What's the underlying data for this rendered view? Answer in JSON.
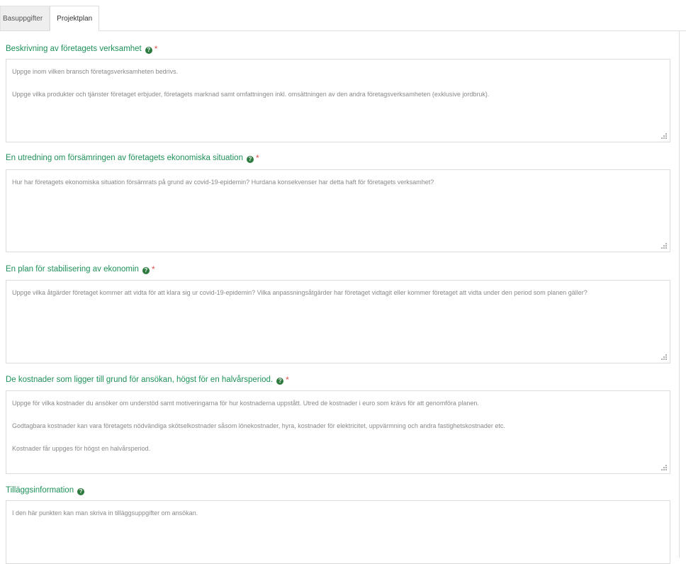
{
  "tabs": [
    {
      "label": "Basuppgifter"
    },
    {
      "label": "Projektplan"
    }
  ],
  "fields": [
    {
      "label": "Beskrivning av företagets verksamhet",
      "required_mark": "*",
      "placeholder_lines": [
        "Uppge inom vilken bransch företagsverksamheten bedrivs.",
        "Uppge vilka produkter och tjänster företaget erbjuder, företagets marknad samt omfattningen inkl. omsättningen av den andra företagsverksamheten (exklusive jordbruk)."
      ]
    },
    {
      "label": "En utredning om försämringen av företagets ekonomiska situation",
      "required_mark": "*",
      "placeholder_lines": [
        "Hur har företagets ekonomiska situation försämrats på grund av covid-19-epidemin? Hurdana konsekvenser har detta haft för företagets verksamhet?"
      ]
    },
    {
      "label": "En plan för stabilisering av ekonomin",
      "required_mark": "*",
      "placeholder_lines": [
        "Uppge vilka åtgärder företaget kommer att vidta för att klara sig ur covid-19-epidemin? Vilka anpassningsåtgärder har företaget vidtagit eller kommer företaget att vidta under den period som planen gäller?"
      ]
    },
    {
      "label": "De kostnader som ligger till grund för ansökan, högst för en halvårsperiod.",
      "required_mark": "*",
      "placeholder_lines": [
        "Uppge för vilka kostnader du ansöker om understöd samt motiveringarna för hur kostnaderna uppstått. Utred de kostnader i euro som krävs för att genomföra planen.",
        "Godtagbara kostnader kan vara företagets nödvändiga skötselkostnader såsom lönekostnader, hyra, kostnader för elektricitet, uppvärmning och andra fastighetskostnader etc.",
        "Kostnader får uppges för högst en halvårsperiod."
      ]
    },
    {
      "label": "Tilläggsinformation",
      "required_mark": "",
      "placeholder_lines": [
        "I den här punkten kan man skriva in tilläggsuppgifter om ansökan."
      ]
    }
  ],
  "icons": {
    "help": "help-icon",
    "resize": "resize-grip-icon"
  },
  "colors": {
    "label_green": "#1e9158",
    "help_icon_bg": "#2c7a3d",
    "required_red": "#d9534f"
  }
}
